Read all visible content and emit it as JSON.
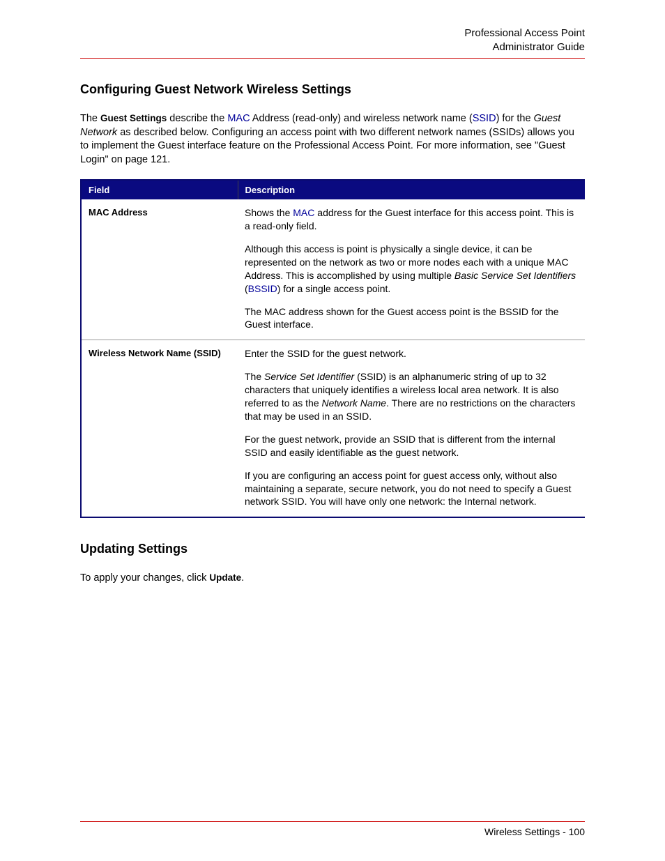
{
  "header": {
    "line1": "Professional Access Point",
    "line2": "Administrator Guide"
  },
  "section1": {
    "heading": "Configuring Guest Network Wireless Settings",
    "intro_parts": {
      "t1": "The ",
      "guest_settings": "Guest Settings",
      "t2": " describe the ",
      "mac_link": "MAC",
      "t3": " Address (read-only) and wireless network name (",
      "ssid_link": "SSID",
      "t4": ") for the ",
      "guest_network_italic": "Guest Network",
      "t5": " as described below. Configuring an access point with two different network names (SSIDs) allows you to implement the Guest interface feature on the Professional Access Point. For more information, see \"Guest Login\" on page 121."
    }
  },
  "table": {
    "headers": {
      "field": "Field",
      "description": "Description"
    },
    "rows": [
      {
        "field": "MAC Address",
        "desc": {
          "p1a": "Shows the ",
          "p1_mac": "MAC",
          "p1b": " address for the Guest interface for this access point. This is a read-only field.",
          "p2a": "Although this access is point is physically a single device, it can be represented on the network as two or more nodes each with a unique MAC Address. This is accomplished by using multiple ",
          "p2_bssid_italic": "Basic Service Set Identifiers",
          "p2b": " (",
          "p2_bssid_link": "BSSID",
          "p2c": ") for a single access point.",
          "p3": "The MAC address shown for the Guest access point is the BSSID for the Guest interface."
        }
      },
      {
        "field": "Wireless Network Name (SSID)",
        "desc": {
          "p1": "Enter the SSID for the guest network.",
          "p2a": "The ",
          "p2_ssi_italic": "Service Set Identifier",
          "p2b": " (SSID) is an alphanumeric string of up to 32 characters that uniquely identifies a wireless local area network. It is also referred to as the ",
          "p2_nn_italic": "Network Name",
          "p2c": ". There are no restrictions on the characters that may be used in an SSID.",
          "p3": "For the guest network, provide an SSID that is different from the internal SSID and easily identifiable as the guest network.",
          "p4": "If you are configuring an access point for guest access only, without also maintaining a separate, secure network, you do not need to specify a Guest network SSID. You will have only one network: the Internal network."
        }
      }
    ]
  },
  "section2": {
    "heading": "Updating Settings",
    "para_a": "To apply your changes, click ",
    "update_bold": "Update",
    "para_b": "."
  },
  "footer": {
    "text": "Wireless Settings - 100"
  }
}
